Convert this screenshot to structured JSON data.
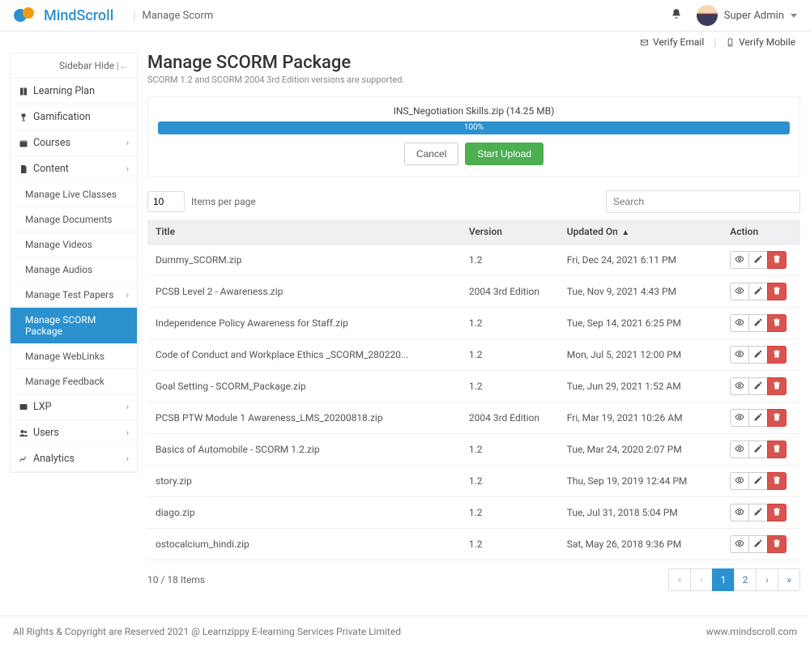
{
  "topbar": {
    "brand": "MindScroll",
    "page_label": "Manage Scorm",
    "user_name": "Super Admin"
  },
  "verify": {
    "email": "Verify Email",
    "mobile": "Verify Mobile"
  },
  "sidebar": {
    "hide_label": "Sidebar Hide",
    "groups": [
      {
        "label": "Learning Plan",
        "icon": "book",
        "expandable": false
      },
      {
        "label": "Gamification",
        "icon": "trophy",
        "expandable": false
      },
      {
        "label": "Courses",
        "icon": "calendar",
        "expandable": true
      },
      {
        "label": "Content",
        "icon": "file",
        "expandable": true,
        "expanded": true,
        "children": [
          {
            "label": "Manage Live Classes"
          },
          {
            "label": "Manage Documents"
          },
          {
            "label": "Manage Videos"
          },
          {
            "label": "Manage Audios"
          },
          {
            "label": "Manage Test Papers",
            "expandable": true
          },
          {
            "label": "Manage SCORM Package",
            "active": true
          },
          {
            "label": "Manage WebLinks"
          },
          {
            "label": "Manage Feedback"
          }
        ]
      },
      {
        "label": "LXP",
        "icon": "lxp",
        "expandable": true
      },
      {
        "label": "Users",
        "icon": "users",
        "expandable": true
      },
      {
        "label": "Analytics",
        "icon": "chart",
        "expandable": true
      }
    ]
  },
  "page": {
    "title": "Manage SCORM Package",
    "subtitle": "SCORM 1.2 and SCORM 2004 3rd Edition versions are supported."
  },
  "upload": {
    "file_label": "INS_Negotiation Skills.zip (14.25 MB)",
    "progress_text": "100%",
    "cancel": "Cancel",
    "start": "Start Upload"
  },
  "toolbar": {
    "items_per_page_value": "10",
    "items_per_page_label": "Items per page",
    "search_placeholder": "Search"
  },
  "table": {
    "headers": {
      "title": "Title",
      "version": "Version",
      "updated": "Updated On",
      "action": "Action"
    },
    "sort_col": "updated",
    "sort_dir": "asc",
    "rows": [
      {
        "title": "Dummy_SCORM.zip",
        "version": "1.2",
        "updated": "Fri, Dec 24, 2021 6:11 PM"
      },
      {
        "title": "PCSB Level 2 - Awareness.zip",
        "version": "2004 3rd Edition",
        "updated": "Tue, Nov 9, 2021 4:43 PM"
      },
      {
        "title": "Independence Policy Awareness for Staff.zip",
        "version": "1.2",
        "updated": "Tue, Sep 14, 2021 6:25 PM"
      },
      {
        "title": "Code of Conduct and Workplace Ethics _SCORM_280220...",
        "version": "1.2",
        "updated": "Mon, Jul 5, 2021 12:00 PM"
      },
      {
        "title": "Goal Setting - SCORM_Package.zip",
        "version": "1.2",
        "updated": "Tue, Jun 29, 2021 1:52 AM"
      },
      {
        "title": "PCSB PTW Module 1 Awareness_LMS_20200818.zip",
        "version": "2004 3rd Edition",
        "updated": "Fri, Mar 19, 2021 10:26 AM"
      },
      {
        "title": "Basics of Automobile - SCORM 1.2.zip",
        "version": "1.2",
        "updated": "Tue, Mar 24, 2020 2:07 PM"
      },
      {
        "title": "story.zip",
        "version": "1.2",
        "updated": "Thu, Sep 19, 2019 12:44 PM"
      },
      {
        "title": "diago.zip",
        "version": "1.2",
        "updated": "Tue, Jul 31, 2018 5:04 PM"
      },
      {
        "title": "ostocalcium_hindi.zip",
        "version": "1.2",
        "updated": "Sat, May 26, 2018 9:36 PM"
      }
    ],
    "footer_count": "10 / 18 Items",
    "pages": [
      "«",
      "‹",
      "1",
      "2",
      "›",
      "»"
    ],
    "active_page": "1"
  },
  "footer": {
    "left": "All Rights & Copyright are Reserved 2021 @ Learnzippy E-learning Services Private Limited",
    "right": "www.mindscroll.com"
  }
}
